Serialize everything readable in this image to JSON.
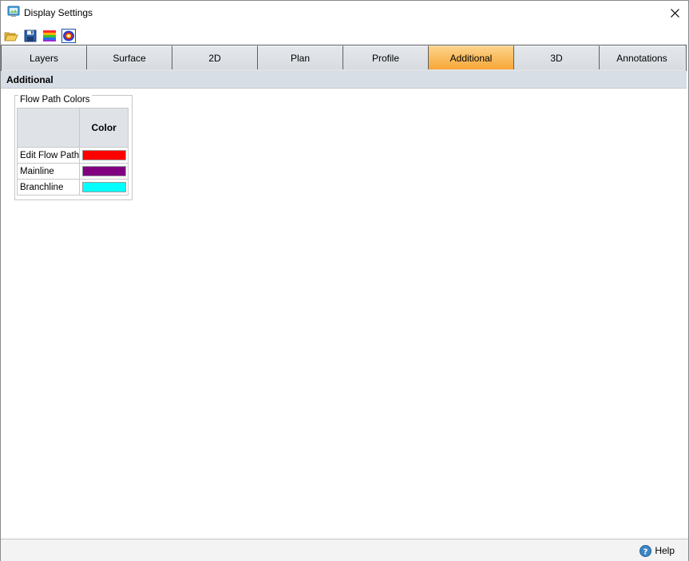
{
  "window": {
    "title": "Display Settings"
  },
  "toolbar": {
    "buttons": [
      {
        "icon": "folder-open-icon"
      },
      {
        "icon": "save-icon"
      },
      {
        "icon": "color-ramp-icon"
      },
      {
        "icon": "color-palette-icon"
      }
    ]
  },
  "tabs": [
    {
      "label": "Layers",
      "active": false
    },
    {
      "label": "Surface",
      "active": false
    },
    {
      "label": "2D",
      "active": false
    },
    {
      "label": "Plan",
      "active": false
    },
    {
      "label": "Profile",
      "active": false
    },
    {
      "label": "Additional",
      "active": true
    },
    {
      "label": "3D",
      "active": false
    },
    {
      "label": "Annotations",
      "active": false
    }
  ],
  "section": {
    "title": "Additional"
  },
  "flow_path_colors": {
    "group_title": "Flow Path Colors",
    "column_header": "Color",
    "rows": [
      {
        "label": "Edit Flow Path",
        "color": "#ff0000"
      },
      {
        "label": "Mainline",
        "color": "#800080"
      },
      {
        "label": "Branchline",
        "color": "#00ffff"
      }
    ]
  },
  "footer": {
    "help_label": "Help"
  },
  "colors": {
    "active_tab": "#f7a637",
    "header_bg": "#d8dee5"
  }
}
